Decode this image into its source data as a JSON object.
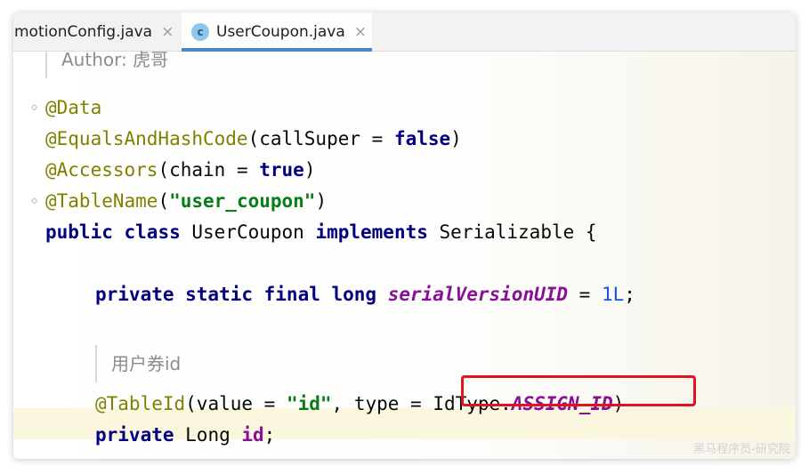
{
  "tabs": [
    {
      "label": "motionConfig.java",
      "close": "×",
      "active": false
    },
    {
      "label": "UserCoupon.java",
      "close": "×",
      "active": true,
      "icon_letter": "c",
      "icon": "class-icon"
    }
  ],
  "doc_comment_top": "Author: 虎哥",
  "code": {
    "data_annotation": "@Data",
    "equals_annotation": "@EqualsAndHashCode",
    "equals_args_open": "(callSuper = ",
    "equals_false": "false",
    "equals_close": ")",
    "accessors_annotation": "@Accessors",
    "accessors_args_open": "(chain = ",
    "accessors_true": "true",
    "accessors_close": ")",
    "tablename_annotation": "@TableName",
    "tablename_open": "(",
    "tablename_value": "\"user_coupon\"",
    "tablename_close": ")",
    "class_kw_public": "public",
    "class_kw_class": "class",
    "class_name": " UserCoupon ",
    "class_kw_implements": "implements",
    "class_rest": " Serializable {",
    "serial_kw": "private static final long",
    "serial_field": "serialVersionUID",
    "serial_eq": " = ",
    "serial_value": "1L",
    "serial_end": ";",
    "doc_comment_id": "用户券id",
    "tableid_annotation": "@TableId",
    "tableid_open": "(value = ",
    "tableid_value": "\"id\"",
    "tableid_mid": ", type = ",
    "tableid_type": "IdType.",
    "tableid_const": "ASSIGN_ID",
    "tableid_close": ")",
    "field_kw": "private",
    "field_type": " Long ",
    "field_name": "id",
    "field_end": ";"
  },
  "watermark": "黑马程序员-研究院",
  "colors": {
    "annotation": "#808000",
    "keyword": "#000080",
    "string": "#067d17",
    "number": "#1750eb",
    "field": "#871094",
    "highlight_box": "#e0141d",
    "active_tab_underline": "#4a87c8"
  }
}
